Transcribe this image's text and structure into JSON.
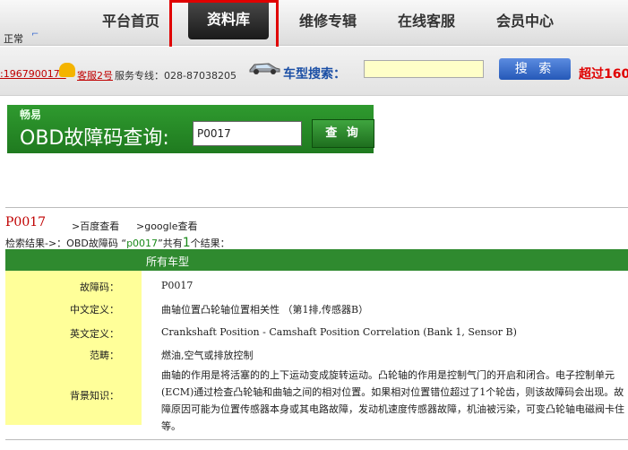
{
  "nav": {
    "items": [
      "平台首页",
      "资料库",
      "维修专辑",
      "在线客服",
      "会员中心"
    ],
    "status": "正常"
  },
  "info": {
    "phone": ":1967900174",
    "kefu": "客服2号",
    "hotline": "服务专线：028-87038205",
    "car_search_label": "车型搜索：",
    "search_button": "搜 索",
    "over_text": "超过160"
  },
  "obd": {
    "small_label": "畅易",
    "title": "OBD故障码查询:",
    "input_value": "P0017",
    "button": "查 询"
  },
  "result": {
    "code": "P0017",
    "baidu_link": ">百度查看",
    "google_link": ">google查看",
    "prefix": "检索结果->：OBD故障码",
    "query": "p0017",
    "middle": "共有",
    "count": "1",
    "suffix": "个结果："
  },
  "table": {
    "header": "所有车型",
    "rows": [
      {
        "label": "故障码：",
        "value": "P0017"
      },
      {
        "label": "中文定义：",
        "value": "曲轴位置凸轮轴位置相关性 （第1排,传感器B）"
      },
      {
        "label": "英文定义：",
        "value": "Crankshaft Position - Camshaft Position Correlation (Bank 1, Sensor B)"
      },
      {
        "label": "范畴：",
        "value": "燃油,空气或排放控制"
      },
      {
        "label": "背景知识：",
        "value": "曲轴的作用是将活塞的的上下运动变成旋转运动。凸轮轴的作用是控制气门的开启和闭合。电子控制单元(ECM)通过检查凸轮轴和曲轴之间的相对位置。如果相对位置错位超过了1个轮齿，则该故障码会出现。故障原因可能为位置传感器本身或其电路故障，发动机速度传感器故障，机油被污染，可变凸轮轴电磁阀卡住等。"
      }
    ]
  }
}
